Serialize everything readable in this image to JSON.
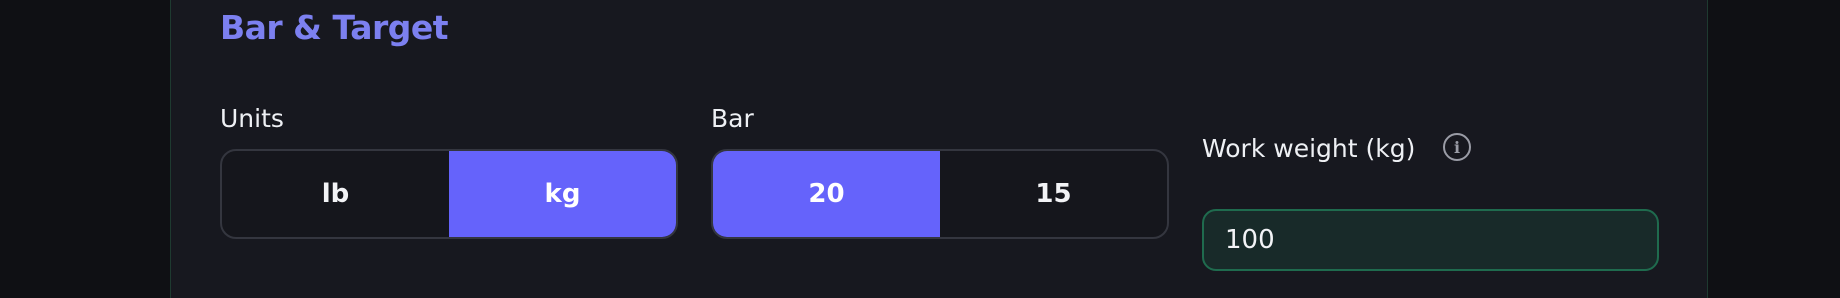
{
  "section": {
    "title": "Bar & Target"
  },
  "units": {
    "label": "Units",
    "options": [
      "lb",
      "kg"
    ],
    "selected": "kg"
  },
  "bar": {
    "label": "Bar",
    "options": [
      "20",
      "15"
    ],
    "selected": "20"
  },
  "work_weight": {
    "label": "Work weight (kg)",
    "value": "100",
    "info_icon": "info-icon"
  },
  "colors": {
    "accent": "#6563fb",
    "title": "#7c80f0",
    "input_border": "#1f6b4e"
  }
}
